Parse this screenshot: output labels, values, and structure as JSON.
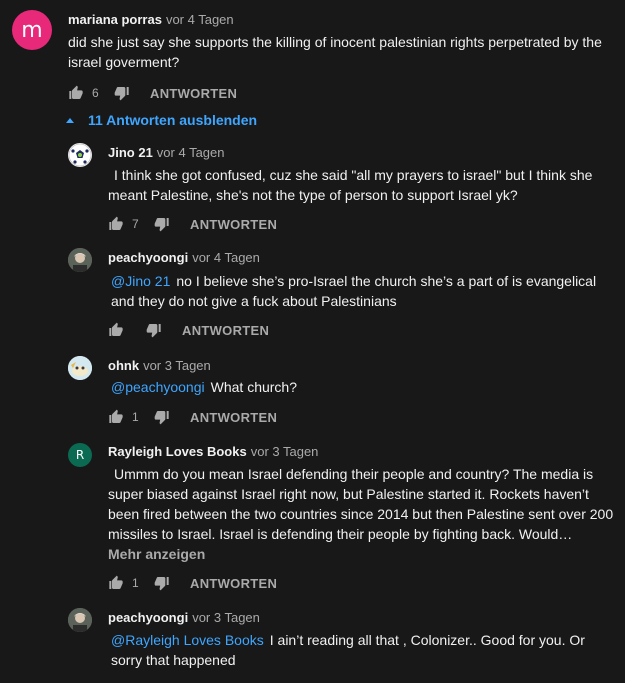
{
  "reply_label": "ANTWORTEN",
  "toggle_replies_label": "11 Antworten ausblenden",
  "show_more_label": "Mehr anzeigen",
  "colors": {
    "background": "#181818",
    "accent": "#3ea6ff",
    "muted": "#aaaaaa",
    "avatar_m": "#e8297a",
    "avatar_r": "#0a6b52"
  },
  "top_comment": {
    "avatar_letter": "m",
    "author": "mariana porras",
    "time": "vor 4 Tagen",
    "text": "did she just say she supports the killing of inocent palestinian rights perpetrated by the israel goverment?",
    "likes": "6"
  },
  "replies": [
    {
      "author": "Jino 21",
      "time": "vor 4 Tagen",
      "mention": "",
      "text": "I think she got confused, cuz she said \"all my prayers to israel\" but I think she meant Palestine, she's not the type of person to support Israel yk?",
      "likes": "7"
    },
    {
      "author": "peachyoongi",
      "time": "vor 4 Tagen",
      "mention": "@Jino 21",
      "text": "no I believe she’s pro-Israel the church she’s a part of is evangelical and they do not give a fuck about Palestinians",
      "likes": ""
    },
    {
      "author": "ohnk",
      "time": "vor 3 Tagen",
      "mention": "@peachyoongi",
      "text": "What church?",
      "likes": "1"
    },
    {
      "avatar_letter": "R",
      "author": "Rayleigh Loves Books",
      "time": "vor 3 Tagen",
      "mention": "",
      "text": "Ummm do you mean Israel defending their people and country? The media is super biased against Israel right now, but Palestine started it. Rockets haven’t been fired between the two countries since 2014 but then Palestine sent over 200 missiles to Israel. Israel is defending their people by fighting back. Would…",
      "likes": "1"
    },
    {
      "author": "peachyoongi",
      "time": "vor 3 Tagen",
      "mention": "@Rayleigh Loves Books",
      "text": "I ain’t reading all that , Colonizer.. Good for you. Or sorry that happened",
      "likes": ""
    }
  ]
}
